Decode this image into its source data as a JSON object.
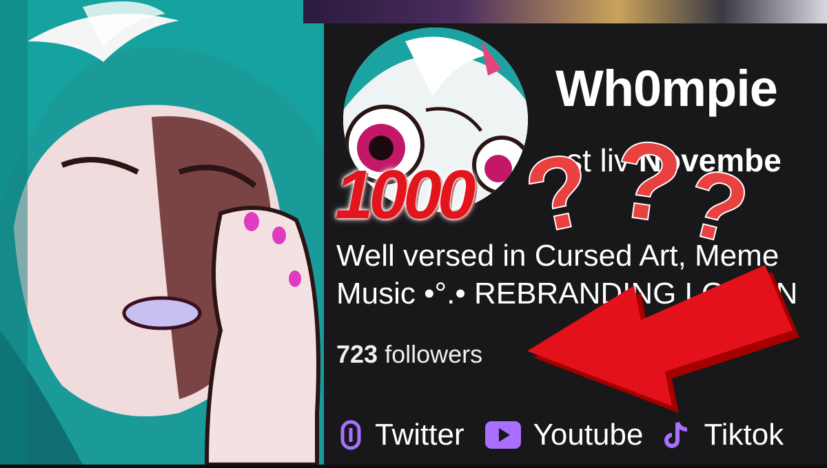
{
  "thumbnail": {
    "overlay_number": "1000",
    "question_marks": [
      "?",
      "?",
      "?"
    ],
    "accent_red": "#e1151b"
  },
  "channel": {
    "name": "Wh0mpie",
    "last_live_prefix": "st liv",
    "last_live_month": "Novembe",
    "bio_line1": "Well versed in Cursed Art, Meme",
    "bio_line2": "Music •°.• REBRANDING LOADIN",
    "followers_count": "723",
    "followers_label": "followers"
  },
  "social_links": [
    {
      "label": "Twitter",
      "icon": "link-icon"
    },
    {
      "label": "Youtube",
      "icon": "youtube-icon"
    },
    {
      "label": "Tiktok",
      "icon": "tiktok-icon"
    }
  ],
  "colors": {
    "panel_bg": "#18181b",
    "icon_purple": "#a970ff",
    "text": "#ffffff"
  }
}
